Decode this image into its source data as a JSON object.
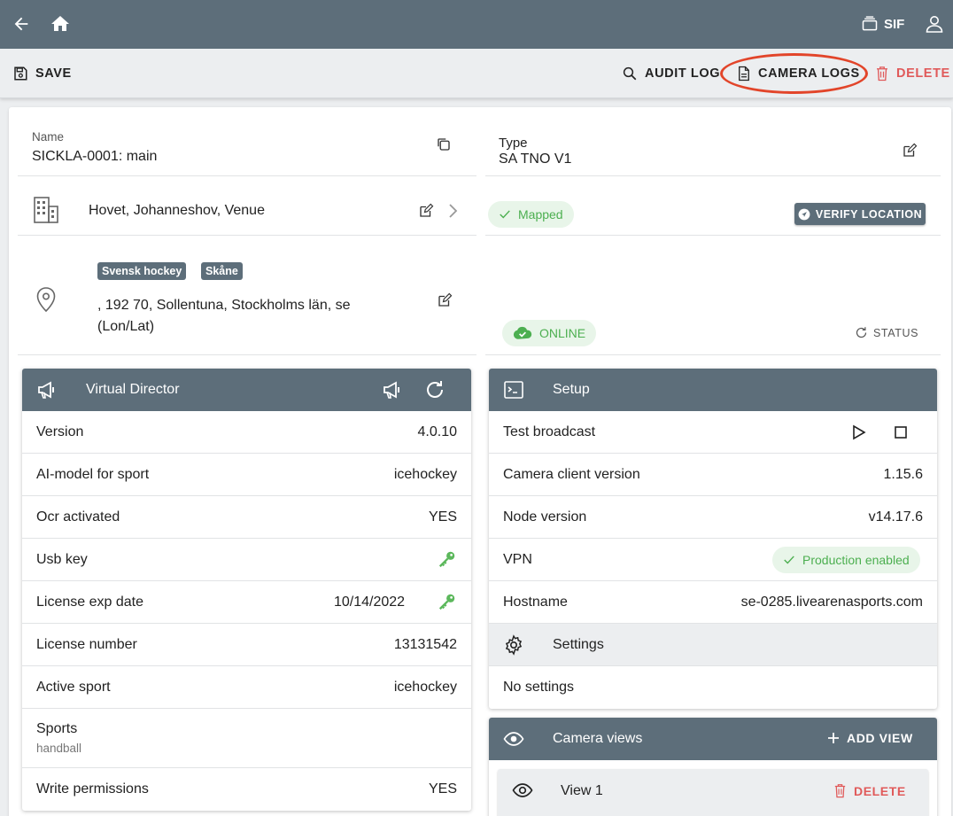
{
  "appbar": {
    "org_label": "SIF",
    "icons": [
      "back-arrow-icon",
      "home-icon",
      "organization-icon",
      "account-icon"
    ]
  },
  "toolbar": {
    "save_label": "SAVE",
    "audit_log_label": "AUDIT LOG",
    "camera_logs_label": "CAMERA LOGS",
    "delete_label": "DELETE",
    "danger_color": "#e05a5a",
    "highlight_color": "#e2452a"
  },
  "camera": {
    "name_label": "Name",
    "name_value": "SICKLA-0001: main",
    "type_label": "Type",
    "type_value": "SA TNO V1",
    "venue": "Hovet, Johanneshov, Venue",
    "mapped_label": "Mapped",
    "verify_location_label": "VERIFY LOCATION",
    "tags": [
      "Svensk hockey",
      "Skåne"
    ],
    "address_line1": ", 192 70, Sollentuna, Stockholms län, se",
    "address_line2": "(Lon/Lat)",
    "online_label": "ONLINE",
    "status_label": "STATUS"
  },
  "virtual_director": {
    "title": "Virtual Director",
    "rows": [
      {
        "key": "Version",
        "value": "4.0.10"
      },
      {
        "key": "AI-model for sport",
        "value": "icehockey"
      },
      {
        "key": "Ocr activated",
        "value": "YES"
      },
      {
        "key": "Usb key",
        "value": ""
      },
      {
        "key": "License exp date",
        "value": "10/14/2022"
      },
      {
        "key": "License number",
        "value": "13131542"
      },
      {
        "key": "Active sport",
        "value": "icehockey"
      },
      {
        "key": "Sports",
        "value": "handball"
      },
      {
        "key": "Write permissions",
        "value": "YES"
      }
    ]
  },
  "setup": {
    "title": "Setup",
    "test_broadcast_label": "Test broadcast",
    "camera_client_version_label": "Camera client version",
    "camera_client_version": "1.15.6",
    "node_version_label": "Node version",
    "node_version": "v14.17.6",
    "vpn_label": "VPN",
    "vpn_status": "Production enabled",
    "hostname_label": "Hostname",
    "hostname": "se-0285.livearenasports.com",
    "settings_label": "Settings",
    "no_settings_label": "No settings"
  },
  "camera_views": {
    "title": "Camera views",
    "add_view_label": "ADD VIEW",
    "views": [
      {
        "name": "View 1",
        "delete_label": "DELETE"
      }
    ]
  },
  "colors": {
    "appbar": "#5d6e7a",
    "success": "#4caf50",
    "key_green": "#5cb85c"
  }
}
